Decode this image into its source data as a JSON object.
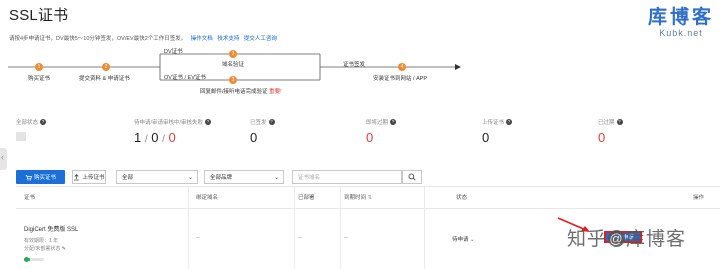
{
  "header": {
    "title": "SSL证书"
  },
  "watermark_top": {
    "main": "库博客",
    "sub": "Kubk.net"
  },
  "notice": {
    "text": "请按4步申请证书，DV最快5～10分钟签发，OV/EV最快2个工作日签发。",
    "links": [
      "操作文档",
      "技术支持",
      "提交人工咨询"
    ]
  },
  "flow": {
    "steps": [
      {
        "num": "1",
        "label": "购买证书"
      },
      {
        "num": "2",
        "label": "提交资料 & 申请证书"
      },
      {
        "num": "3",
        "label": "域名验证",
        "branch": "DV证书"
      },
      {
        "num": "3",
        "label": "回复邮件/接听电话完成验证",
        "emphasis": "重要!",
        "branch": "OV证书 / EV证书"
      },
      {
        "num": "4",
        "label": "安装证书到网站 / APP",
        "pre": "证书签发"
      }
    ]
  },
  "stats": [
    {
      "label": "全部状态",
      "value": ""
    },
    {
      "label": "待申请/审请审核中/审核失败",
      "value_parts": [
        "1",
        "0",
        "0"
      ]
    },
    {
      "label": "已签发",
      "value": "0"
    },
    {
      "label": "即将过期",
      "value": "0",
      "red": true
    },
    {
      "label": "上传证书",
      "value": "0"
    },
    {
      "label": "已过期",
      "value": "0",
      "red": true
    }
  ],
  "toolbar": {
    "buy_label": "购买证书",
    "upload_label": "上传证书",
    "select_status": "全部",
    "select_brand": "全部品牌",
    "search_placeholder": "证书域名"
  },
  "table": {
    "headers": [
      "证书",
      "绑定域名",
      "已部署",
      "到期时间",
      "状态",
      "操作"
    ],
    "sort_icon": "sort-icon",
    "rows": [
      {
        "name": "DigiCert 免费版 SSL",
        "validity": "有效期限：1 年",
        "domain_meta": "分配/未部署状态",
        "domain": "--",
        "deployed": "--",
        "expires": "--",
        "status": "待申请",
        "progress": 0.3,
        "action": "证书申请"
      }
    ]
  },
  "watermark_bottom": {
    "left": "知乎",
    "at": "@",
    "right": "库博客"
  },
  "colors": {
    "primary": "#1a6fd8",
    "accent": "#f28b30",
    "danger": "#e23b3b"
  }
}
